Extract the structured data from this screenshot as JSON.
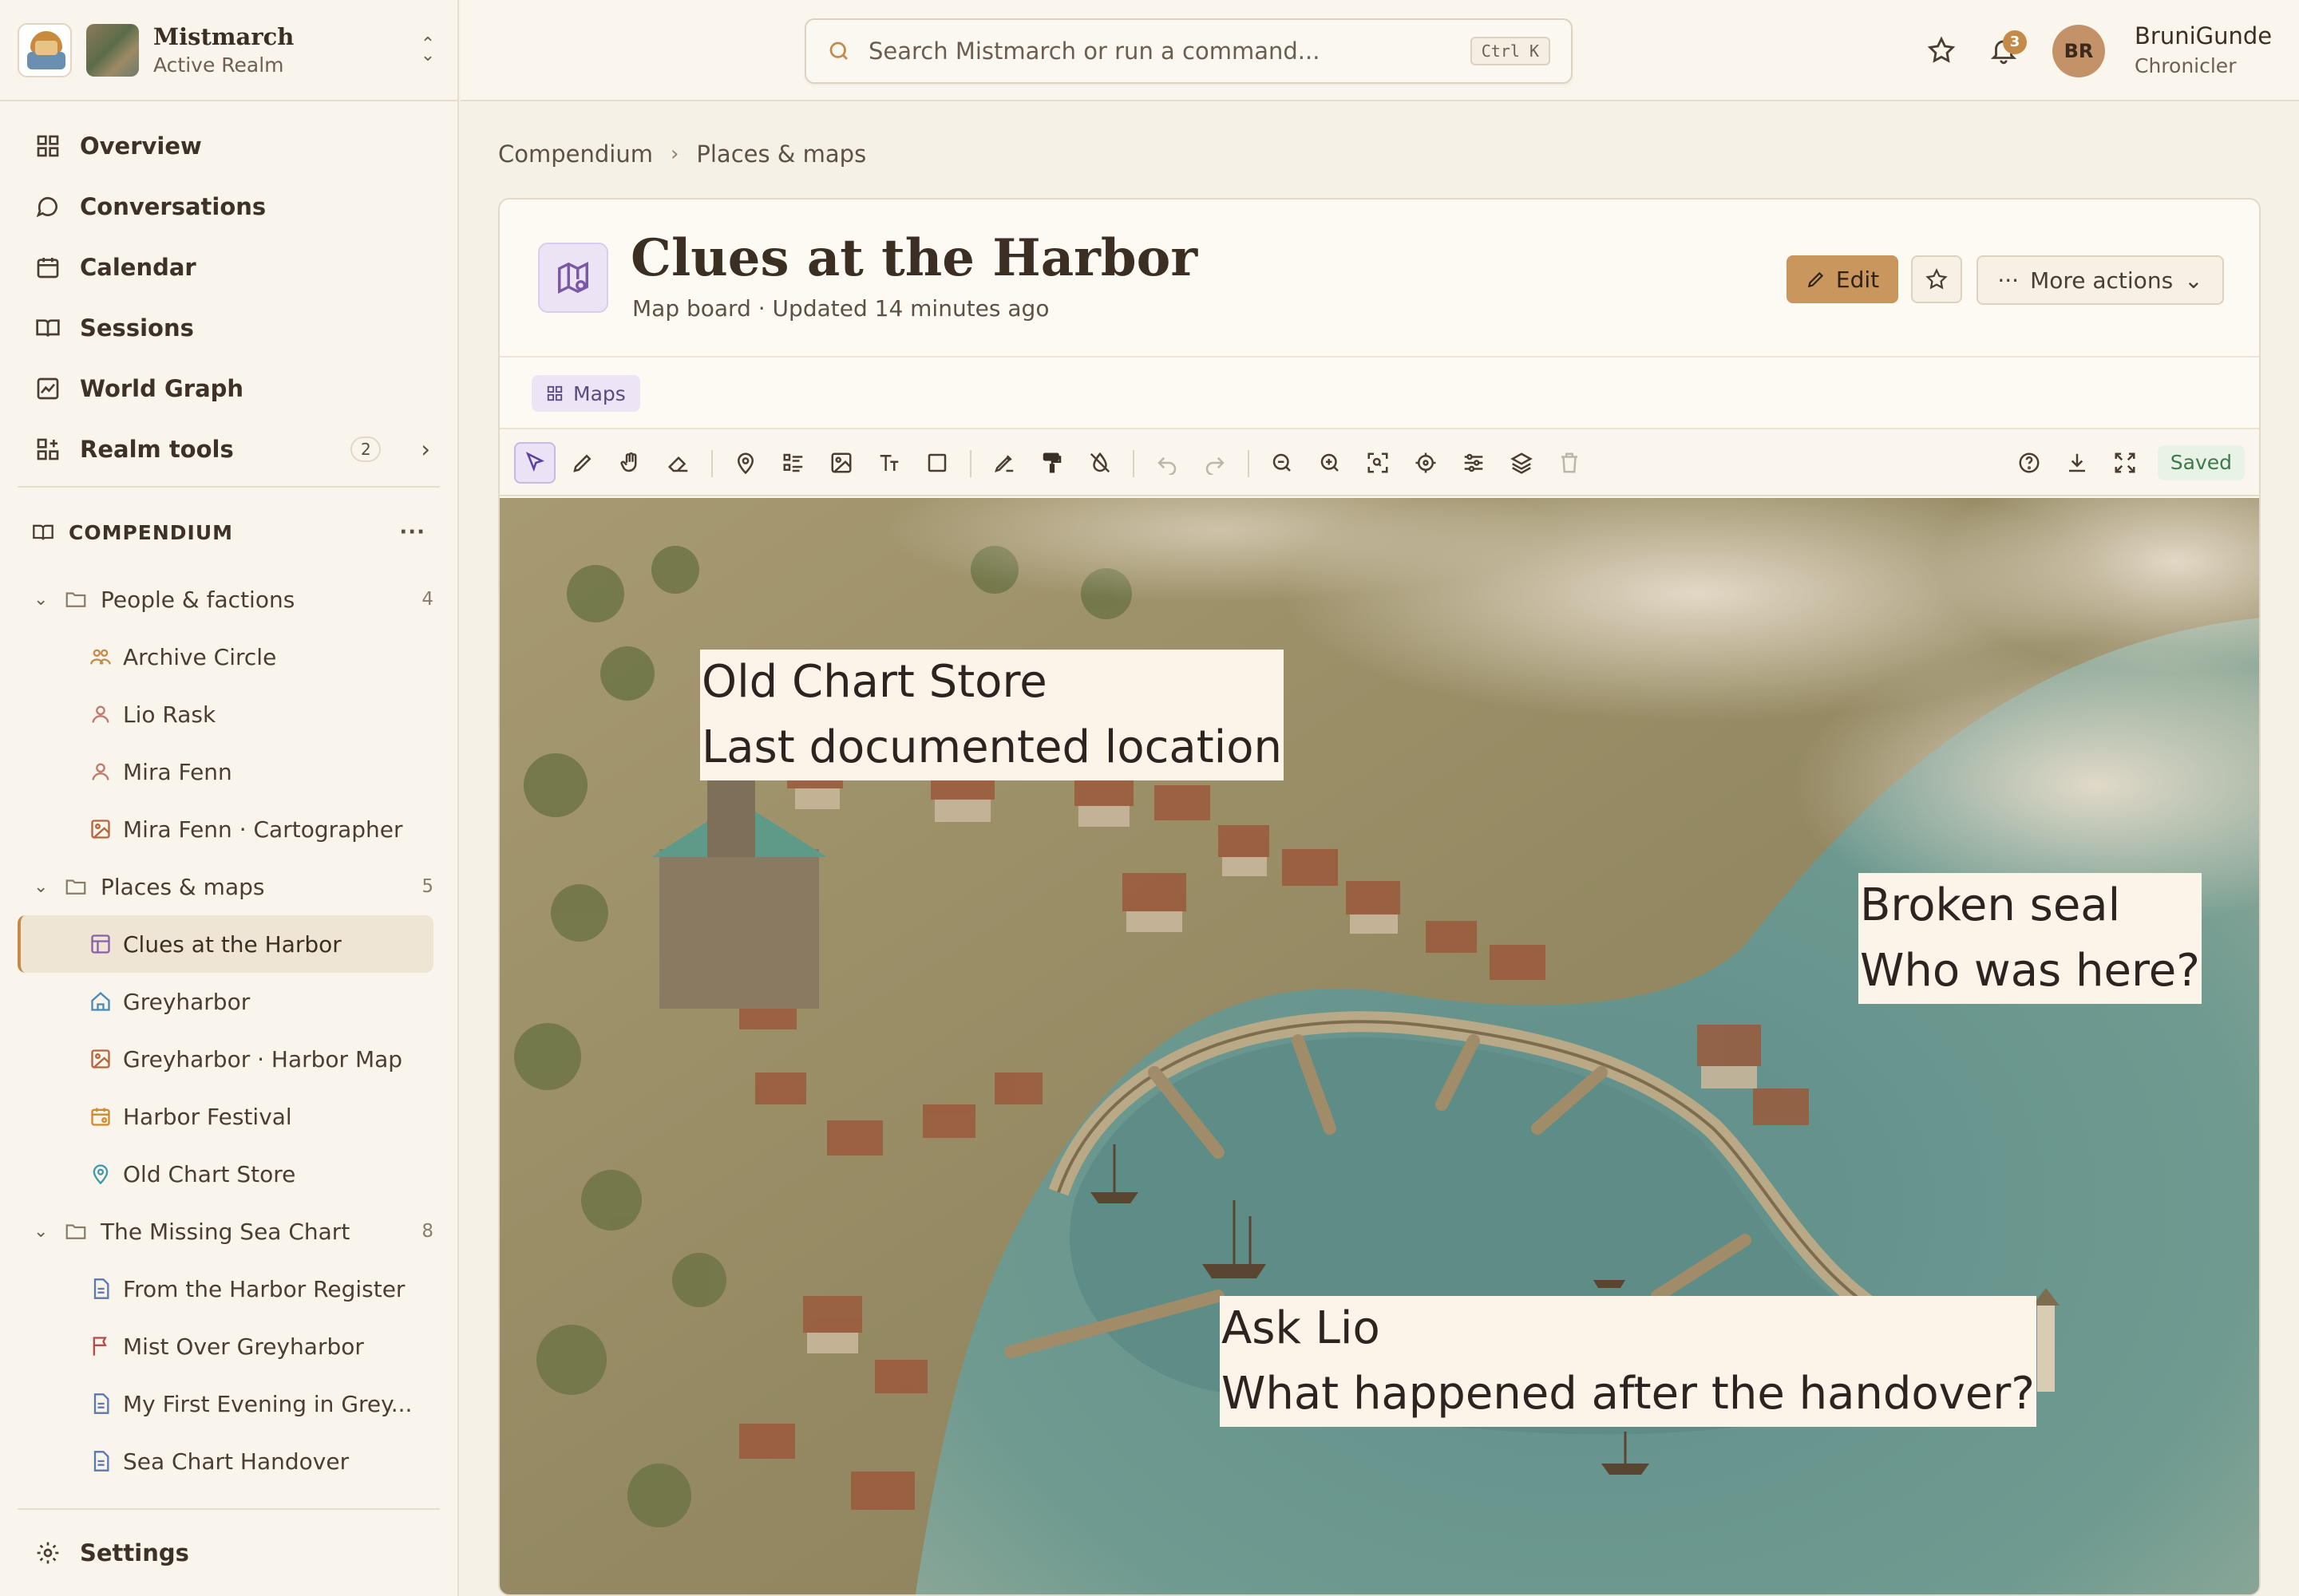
{
  "realm": {
    "name": "Mistmarch",
    "subtitle": "Active Realm"
  },
  "nav": [
    {
      "label": "Overview",
      "icon": "grid-icon"
    },
    {
      "label": "Conversations",
      "icon": "chat-icon"
    },
    {
      "label": "Calendar",
      "icon": "calendar-icon"
    },
    {
      "label": "Sessions",
      "icon": "book-icon"
    },
    {
      "label": "World Graph",
      "icon": "graph-icon"
    },
    {
      "label": "Realm tools",
      "icon": "tools-icon",
      "badge": "2"
    }
  ],
  "compendium": {
    "title": "COMPENDIUM",
    "folders": [
      {
        "label": "People & factions",
        "count": "4",
        "items": [
          {
            "label": "Archive Circle",
            "icon": "group-icon"
          },
          {
            "label": "Lio Rask",
            "icon": "person-icon"
          },
          {
            "label": "Mira Fenn",
            "icon": "person-icon"
          },
          {
            "label": "Mira Fenn · Cartographer",
            "icon": "image-icon"
          }
        ]
      },
      {
        "label": "Places & maps",
        "count": "5",
        "items": [
          {
            "label": "Clues at the Harbor",
            "icon": "board-icon",
            "active": true
          },
          {
            "label": "Greyharbor",
            "icon": "home-icon"
          },
          {
            "label": "Greyharbor · Harbor Map",
            "icon": "image-icon"
          },
          {
            "label": "Harbor Festival",
            "icon": "event-icon"
          },
          {
            "label": "Old Chart Store",
            "icon": "pin-icon"
          }
        ]
      },
      {
        "label": "The Missing Sea Chart",
        "count": "8",
        "items": [
          {
            "label": "From the Harbor Register",
            "icon": "doc-icon"
          },
          {
            "label": "Mist Over Greyharbor",
            "icon": "flag-icon"
          },
          {
            "label": "My First Evening in Grey...",
            "icon": "doc-icon"
          },
          {
            "label": "Sea Chart Handover",
            "icon": "doc-icon"
          }
        ]
      }
    ]
  },
  "settings_label": "Settings",
  "search": {
    "placeholder": "Search Mistmarch or run a command...",
    "shortcut": "Ctrl K"
  },
  "notifications_count": "3",
  "user": {
    "initials": "BR",
    "name": "BruniGunde",
    "role": "Chronicler"
  },
  "breadcrumb": [
    "Compendium",
    "Places & maps"
  ],
  "page": {
    "title": "Clues at the Harbor",
    "meta": "Map board · Updated 14 minutes ago",
    "edit_label": "Edit",
    "more_label": "More actions",
    "tag": "Maps"
  },
  "toolbar": {
    "saved_label": "Saved"
  },
  "map_notes": [
    {
      "line1": "Old Chart Store",
      "line2": "Last documented location"
    },
    {
      "line1": "Broken seal",
      "line2": "Who was here?"
    },
    {
      "line1": "Ask Lio",
      "line2": "What happened after the handover?"
    }
  ],
  "colors": {
    "accent": "#c48a4a",
    "edit_button": "#c9965e",
    "saved_green": "#3c7a4a",
    "tag_purple": "#5a4a80"
  }
}
